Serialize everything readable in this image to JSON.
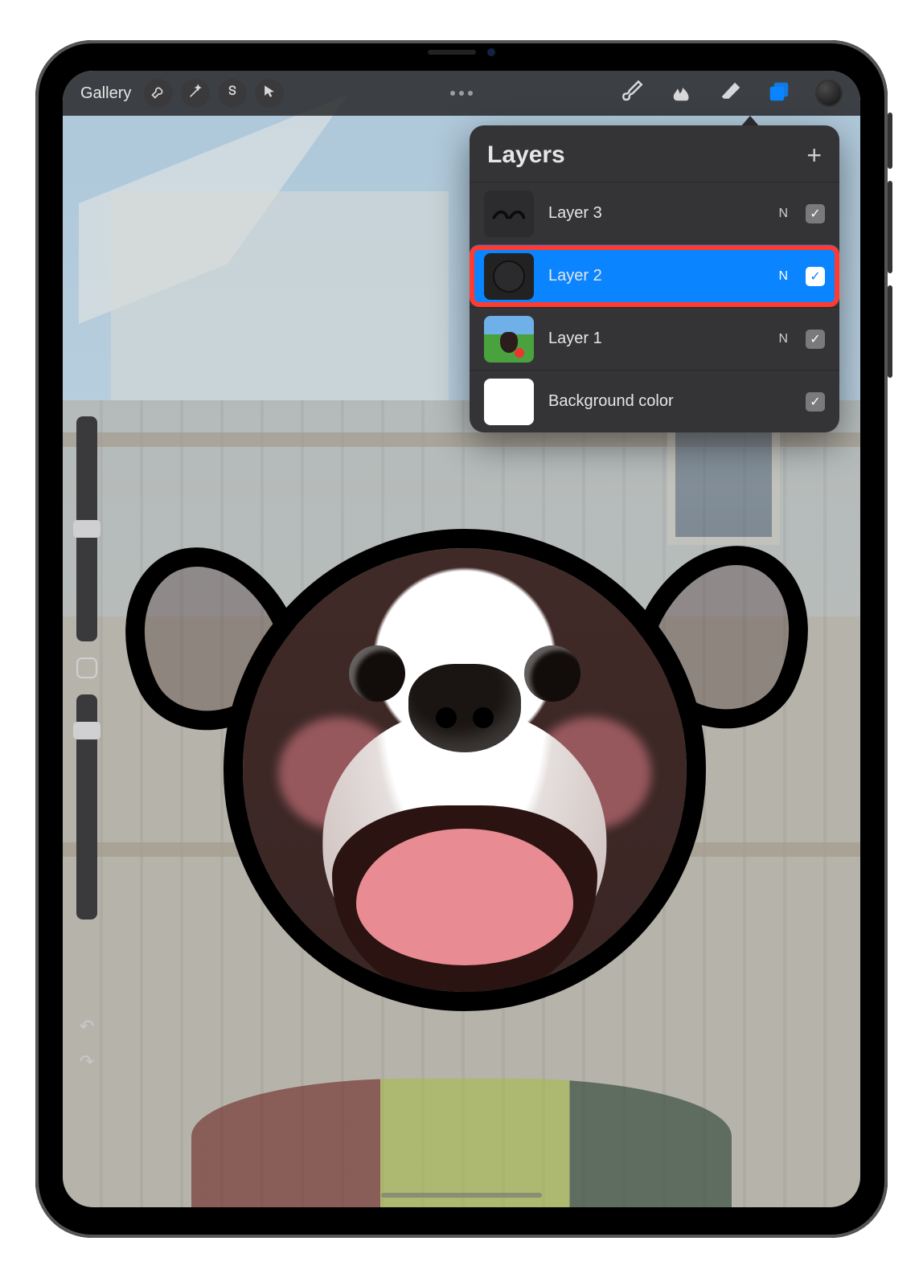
{
  "toolbar": {
    "gallery_label": "Gallery",
    "icons": {
      "wrench": "wrench-icon",
      "wand": "wand-icon",
      "select": "selection-s-icon",
      "move": "cursor-arrow-icon",
      "brush": "brush-icon",
      "smudge": "smudge-icon",
      "eraser": "eraser-icon",
      "layers": "layers-icon"
    },
    "color_swatch": "#0f0f0f"
  },
  "layers_panel": {
    "title": "Layers",
    "add_label": "+",
    "items": [
      {
        "name": "Layer 3",
        "blend": "N",
        "visible": true,
        "selected": false,
        "highlighted": false,
        "thumb": "eyebrows"
      },
      {
        "name": "Layer 2",
        "blend": "N",
        "visible": true,
        "selected": true,
        "highlighted": true,
        "thumb": "mask"
      },
      {
        "name": "Layer 1",
        "blend": "N",
        "visible": true,
        "selected": false,
        "highlighted": false,
        "thumb": "photo"
      },
      {
        "name": "Background color",
        "blend": "",
        "visible": true,
        "selected": false,
        "highlighted": false,
        "thumb": "white"
      }
    ]
  },
  "side_controls": {
    "brush_size_thumb_pos": 0.46,
    "brush_opacity_thumb_pos": 0.12,
    "undo": "↶",
    "redo": "↷"
  }
}
